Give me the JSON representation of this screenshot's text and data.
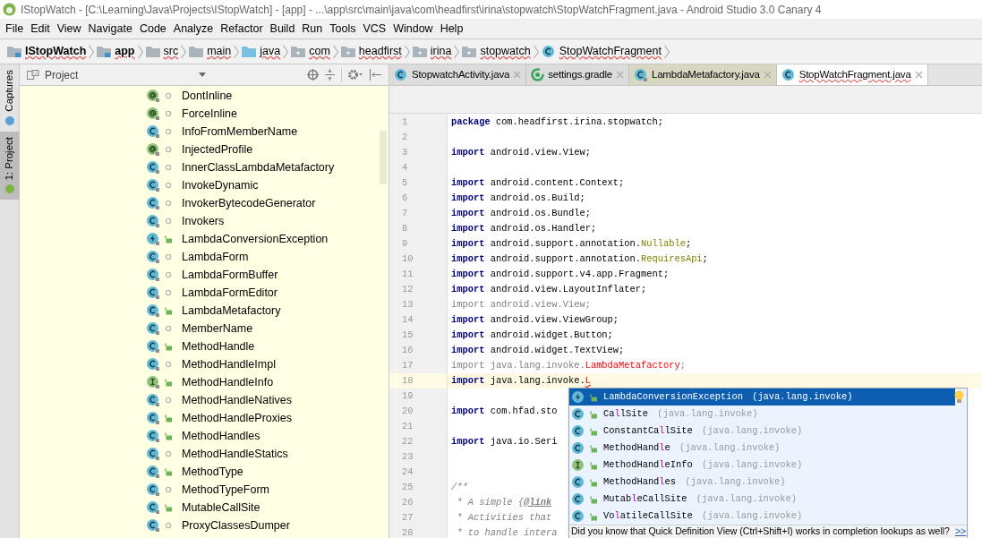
{
  "window": {
    "title": "IStopWatch - [C:\\Learning\\Java\\Projects\\IStopWatch] - [app] - ...\\app\\src\\main\\java\\com\\headfirst\\irina\\stopwatch\\StopWatchFragment.java - Android Studio 3.0 Canary 4"
  },
  "menu": [
    "File",
    "Edit",
    "View",
    "Navigate",
    "Code",
    "Analyze",
    "Refactor",
    "Build",
    "Run",
    "Tools",
    "VCS",
    "Window",
    "Help"
  ],
  "breadcrumb": [
    {
      "label": "IStopWatch",
      "kind": "module"
    },
    {
      "label": "app",
      "kind": "module"
    },
    {
      "label": "src",
      "kind": "folder"
    },
    {
      "label": "main",
      "kind": "folder"
    },
    {
      "label": "java",
      "kind": "source"
    },
    {
      "label": "com",
      "kind": "package"
    },
    {
      "label": "headfirst",
      "kind": "package"
    },
    {
      "label": "irina",
      "kind": "package"
    },
    {
      "label": "stopwatch",
      "kind": "package"
    },
    {
      "label": "StopWatchFragment",
      "kind": "class"
    }
  ],
  "tool_tabs": [
    {
      "label": "Captures",
      "selected": false
    },
    {
      "label": "1: Project",
      "selected": true
    }
  ],
  "project_panel": {
    "title": "Project",
    "items": [
      {
        "label": "DontInline",
        "kind": "annotation",
        "public": false
      },
      {
        "label": "ForceInline",
        "kind": "annotation",
        "public": false
      },
      {
        "label": "InfoFromMemberName",
        "kind": "class",
        "public": false
      },
      {
        "label": "InjectedProfile",
        "kind": "annotation",
        "public": false
      },
      {
        "label": "InnerClassLambdaMetafactory",
        "kind": "class",
        "public": false
      },
      {
        "label": "InvokeDynamic",
        "kind": "class",
        "public": false
      },
      {
        "label": "InvokerBytecodeGenerator",
        "kind": "class",
        "public": false
      },
      {
        "label": "Invokers",
        "kind": "class",
        "public": false
      },
      {
        "label": "LambdaConversionException",
        "kind": "exception",
        "public": true
      },
      {
        "label": "LambdaForm",
        "kind": "class",
        "public": false
      },
      {
        "label": "LambdaFormBuffer",
        "kind": "class",
        "public": false
      },
      {
        "label": "LambdaFormEditor",
        "kind": "class",
        "public": false
      },
      {
        "label": "LambdaMetafactory",
        "kind": "class",
        "public": true
      },
      {
        "label": "MemberName",
        "kind": "class",
        "public": false
      },
      {
        "label": "MethodHandle",
        "kind": "class",
        "public": true
      },
      {
        "label": "MethodHandleImpl",
        "kind": "class",
        "public": false
      },
      {
        "label": "MethodHandleInfo",
        "kind": "interface",
        "public": true
      },
      {
        "label": "MethodHandleNatives",
        "kind": "class",
        "public": false
      },
      {
        "label": "MethodHandleProxies",
        "kind": "class",
        "public": true
      },
      {
        "label": "MethodHandles",
        "kind": "class",
        "public": true
      },
      {
        "label": "MethodHandleStatics",
        "kind": "class",
        "public": false
      },
      {
        "label": "MethodType",
        "kind": "class",
        "public": true
      },
      {
        "label": "MethodTypeForm",
        "kind": "class",
        "public": false
      },
      {
        "label": "MutableCallSite",
        "kind": "class",
        "public": true
      },
      {
        "label": "ProxyClassesDumper",
        "kind": "class",
        "public": false
      }
    ]
  },
  "editor_tabs": [
    {
      "label": "StopwatchActivity.java",
      "kind": "class",
      "selected": false
    },
    {
      "label": "settings.gradle",
      "kind": "gradle",
      "selected": false
    },
    {
      "label": "LambdaMetafactory.java",
      "kind": "library",
      "selected": false
    },
    {
      "label": "StopWatchFragment.java",
      "kind": "class",
      "selected": true
    }
  ],
  "code_lines": [
    {
      "number": "1",
      "current": false,
      "segments": [
        {
          "t": "package",
          "kind": "keyword"
        },
        {
          "t": " com.headfirst.irina.stopwatch;",
          "kind": "plain"
        }
      ]
    },
    {
      "number": "2",
      "current": false
    },
    {
      "number": "3",
      "current": false,
      "segments": [
        {
          "t": "import",
          "kind": "keyword"
        },
        {
          "t": " android.view.View;",
          "kind": "plain"
        }
      ]
    },
    {
      "number": "4",
      "current": false
    },
    {
      "number": "5",
      "current": false,
      "segments": [
        {
          "t": "import",
          "kind": "keyword"
        },
        {
          "t": " android.content.Context;",
          "kind": "plain"
        }
      ]
    },
    {
      "number": "6",
      "current": false,
      "segments": [
        {
          "t": "import",
          "kind": "keyword"
        },
        {
          "t": " android.os.Build;",
          "kind": "plain"
        }
      ]
    },
    {
      "number": "7",
      "current": false,
      "segments": [
        {
          "t": "import",
          "kind": "keyword"
        },
        {
          "t": " android.os.Bundle;",
          "kind": "plain"
        }
      ]
    },
    {
      "number": "8",
      "current": false,
      "segments": [
        {
          "t": "import",
          "kind": "keyword"
        },
        {
          "t": " android.os.Handler;",
          "kind": "plain"
        }
      ]
    },
    {
      "number": "9",
      "current": false,
      "segments": [
        {
          "t": "import",
          "kind": "keyword"
        },
        {
          "t": " android.support.annotation.",
          "kind": "plain"
        },
        {
          "t": "Nullable",
          "kind": "annotation"
        },
        {
          "t": ";",
          "kind": "plain"
        }
      ]
    },
    {
      "number": "10",
      "current": false,
      "segments": [
        {
          "t": "import",
          "kind": "keyword"
        },
        {
          "t": " android.support.annotation.",
          "kind": "plain"
        },
        {
          "t": "RequiresApi",
          "kind": "annotation"
        },
        {
          "t": ";",
          "kind": "plain"
        }
      ]
    },
    {
      "number": "11",
      "current": false,
      "segments": [
        {
          "t": "import",
          "kind": "keyword"
        },
        {
          "t": " android.support.v4.app.Fragment;",
          "kind": "plain"
        }
      ]
    },
    {
      "number": "12",
      "current": false,
      "segments": [
        {
          "t": "import",
          "kind": "keyword"
        },
        {
          "t": " android.view.LayoutInflater;",
          "kind": "plain"
        }
      ]
    },
    {
      "number": "13",
      "current": false,
      "segments": [
        {
          "t": "import android.view.View;",
          "kind": "unused"
        }
      ]
    },
    {
      "number": "14",
      "current": false,
      "segments": [
        {
          "t": "import",
          "kind": "keyword"
        },
        {
          "t": " android.view.ViewGroup;",
          "kind": "plain"
        }
      ]
    },
    {
      "number": "15",
      "current": false,
      "segments": [
        {
          "t": "import",
          "kind": "keyword"
        },
        {
          "t": " android.widget.Button;",
          "kind": "plain"
        }
      ]
    },
    {
      "number": "16",
      "current": false,
      "segments": [
        {
          "t": "import",
          "kind": "keyword"
        },
        {
          "t": " android.widget.TextView;",
          "kind": "plain"
        }
      ]
    },
    {
      "number": "17",
      "current": false,
      "segments": [
        {
          "t": "import java.lang.invoke.",
          "kind": "unused"
        },
        {
          "t": "LambdaMetafactory",
          "kind": "error"
        },
        {
          "t": ";",
          "kind": "unused"
        }
      ]
    },
    {
      "number": "18",
      "current": true,
      "segments": [
        {
          "t": "import",
          "kind": "keyword"
        },
        {
          "t": " java.lang.invoke.",
          "kind": "plain"
        },
        {
          "t": "L",
          "kind": "error"
        }
      ]
    },
    {
      "number": "19",
      "current": false
    },
    {
      "number": "20",
      "current": false,
      "segments": [
        {
          "t": "import",
          "kind": "keyword"
        },
        {
          "t": " com.hfad.sto",
          "kind": "plain"
        }
      ]
    },
    {
      "number": "21",
      "current": false
    },
    {
      "number": "22",
      "current": false,
      "segments": [
        {
          "t": "import",
          "kind": "keyword"
        },
        {
          "t": " java.io.Seri",
          "kind": "plain"
        }
      ]
    },
    {
      "number": "23",
      "current": false
    },
    {
      "number": "24",
      "current": false
    },
    {
      "number": "25",
      "current": false,
      "segments": [
        {
          "t": "/**",
          "kind": "comment"
        }
      ]
    },
    {
      "number": "26",
      "current": false,
      "segments": [
        {
          "t": " * A simple {",
          "kind": "comment"
        },
        {
          "t": "@link",
          "kind": "tag"
        }
      ]
    },
    {
      "number": "27",
      "current": false,
      "segments": [
        {
          "t": " * Activities that",
          "kind": "comment"
        }
      ]
    },
    {
      "number": "28",
      "current": false,
      "segments": [
        {
          "t": " * to handle intera",
          "kind": "comment"
        }
      ]
    }
  ],
  "completion": {
    "items": [
      {
        "name": "**L**ambdaConversionException",
        "package": "(java.lang.invoke)",
        "kind": "exception",
        "selected": true
      },
      {
        "name": "Ca**l**lSite",
        "package": "(java.lang.invoke)",
        "kind": "class",
        "selected": false
      },
      {
        "name": "ConstantCa**l**lSite",
        "package": "(java.lang.invoke)",
        "kind": "class",
        "selected": false
      },
      {
        "name": "MethodHand**l**e",
        "package": "(java.lang.invoke)",
        "kind": "class",
        "selected": false
      },
      {
        "name": "MethodHand**l**eInfo",
        "package": "(java.lang.invoke)",
        "kind": "interface",
        "selected": false
      },
      {
        "name": "MethodHand**l**es",
        "package": "(java.lang.invoke)",
        "kind": "class",
        "selected": false
      },
      {
        "name": "Mutab**l**eCallSite",
        "package": "(java.lang.invoke)",
        "kind": "class",
        "selected": false
      },
      {
        "name": "Vo**l**atileCallSite",
        "package": "(java.lang.invoke)",
        "kind": "class",
        "selected": false
      }
    ],
    "hint": "Did you know that Quick Definition View (Ctrl+Shift+I) works in completion lookups as well?",
    "hint_link": ">>"
  }
}
